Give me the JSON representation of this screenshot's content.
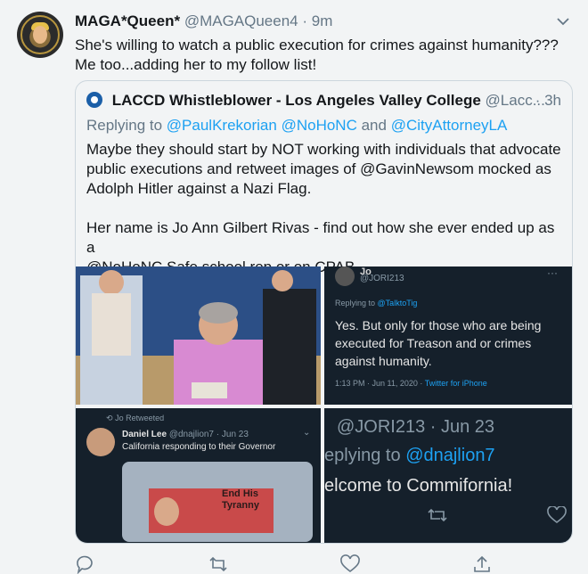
{
  "tweet": {
    "display_name": "MAGA*Queen*",
    "handle": "@MAGAQueen4",
    "time": "9m",
    "text_line1": "She's willing to watch a public execution for crimes against humanity???",
    "text_line2": "Me too...adding her to my follow list!"
  },
  "quoted": {
    "display_name": "LACCD Whistleblower - Los Angeles Valley College",
    "handle": "@Lacc...",
    "time": "3h",
    "replying_label": "Replying to",
    "reply_user1": "@PaulKrekorian",
    "reply_user2": "@NoHoNC",
    "reply_and": "and",
    "reply_user3": "@CityAttorneyLA",
    "line1": "Maybe they should start by NOT working with individuals that advocate",
    "line2": "public executions and retweet images of @GavinNewsom mocked as",
    "line3": "Adolph Hitler against a Nazi Flag.",
    "line4": "Her name is Jo Ann Gilbert Rivas - find out how she ever ended up as a",
    "line5": "@NoHoNC Safe school rep or on CPAB."
  },
  "media2": {
    "user": "Jo",
    "handle": "@JORI213",
    "replying": "Replying to",
    "replying_user": "@TalktoTig",
    "line1": "Yes. But only for those who are being",
    "line2": "executed for Treason and or crimes",
    "line3": "against humanity.",
    "timestamp": "1:13 PM · Jun 11, 2020 ·",
    "client": "Twitter for iPhone"
  },
  "media3": {
    "retweeted": "Jo Retweeted",
    "user": "Daniel Lee",
    "handle": "@dnajlion7 · Jun 23",
    "text": "California responding to their Governor",
    "banner1": "End His",
    "banner2": "Tyranny"
  },
  "media4": {
    "line1": "@JORI213 · Jun 23",
    "line2_prefix": "eplying to",
    "line2_user": "@dnajlion7",
    "line3": "elcome to Commifornia!"
  },
  "icons": [
    "chevron-down-icon",
    "reply-icon",
    "retweet-icon",
    "like-icon",
    "share-icon"
  ],
  "colors": {
    "link": "#1da1f2",
    "muted": "#657786",
    "dark_bg": "#15202b"
  }
}
